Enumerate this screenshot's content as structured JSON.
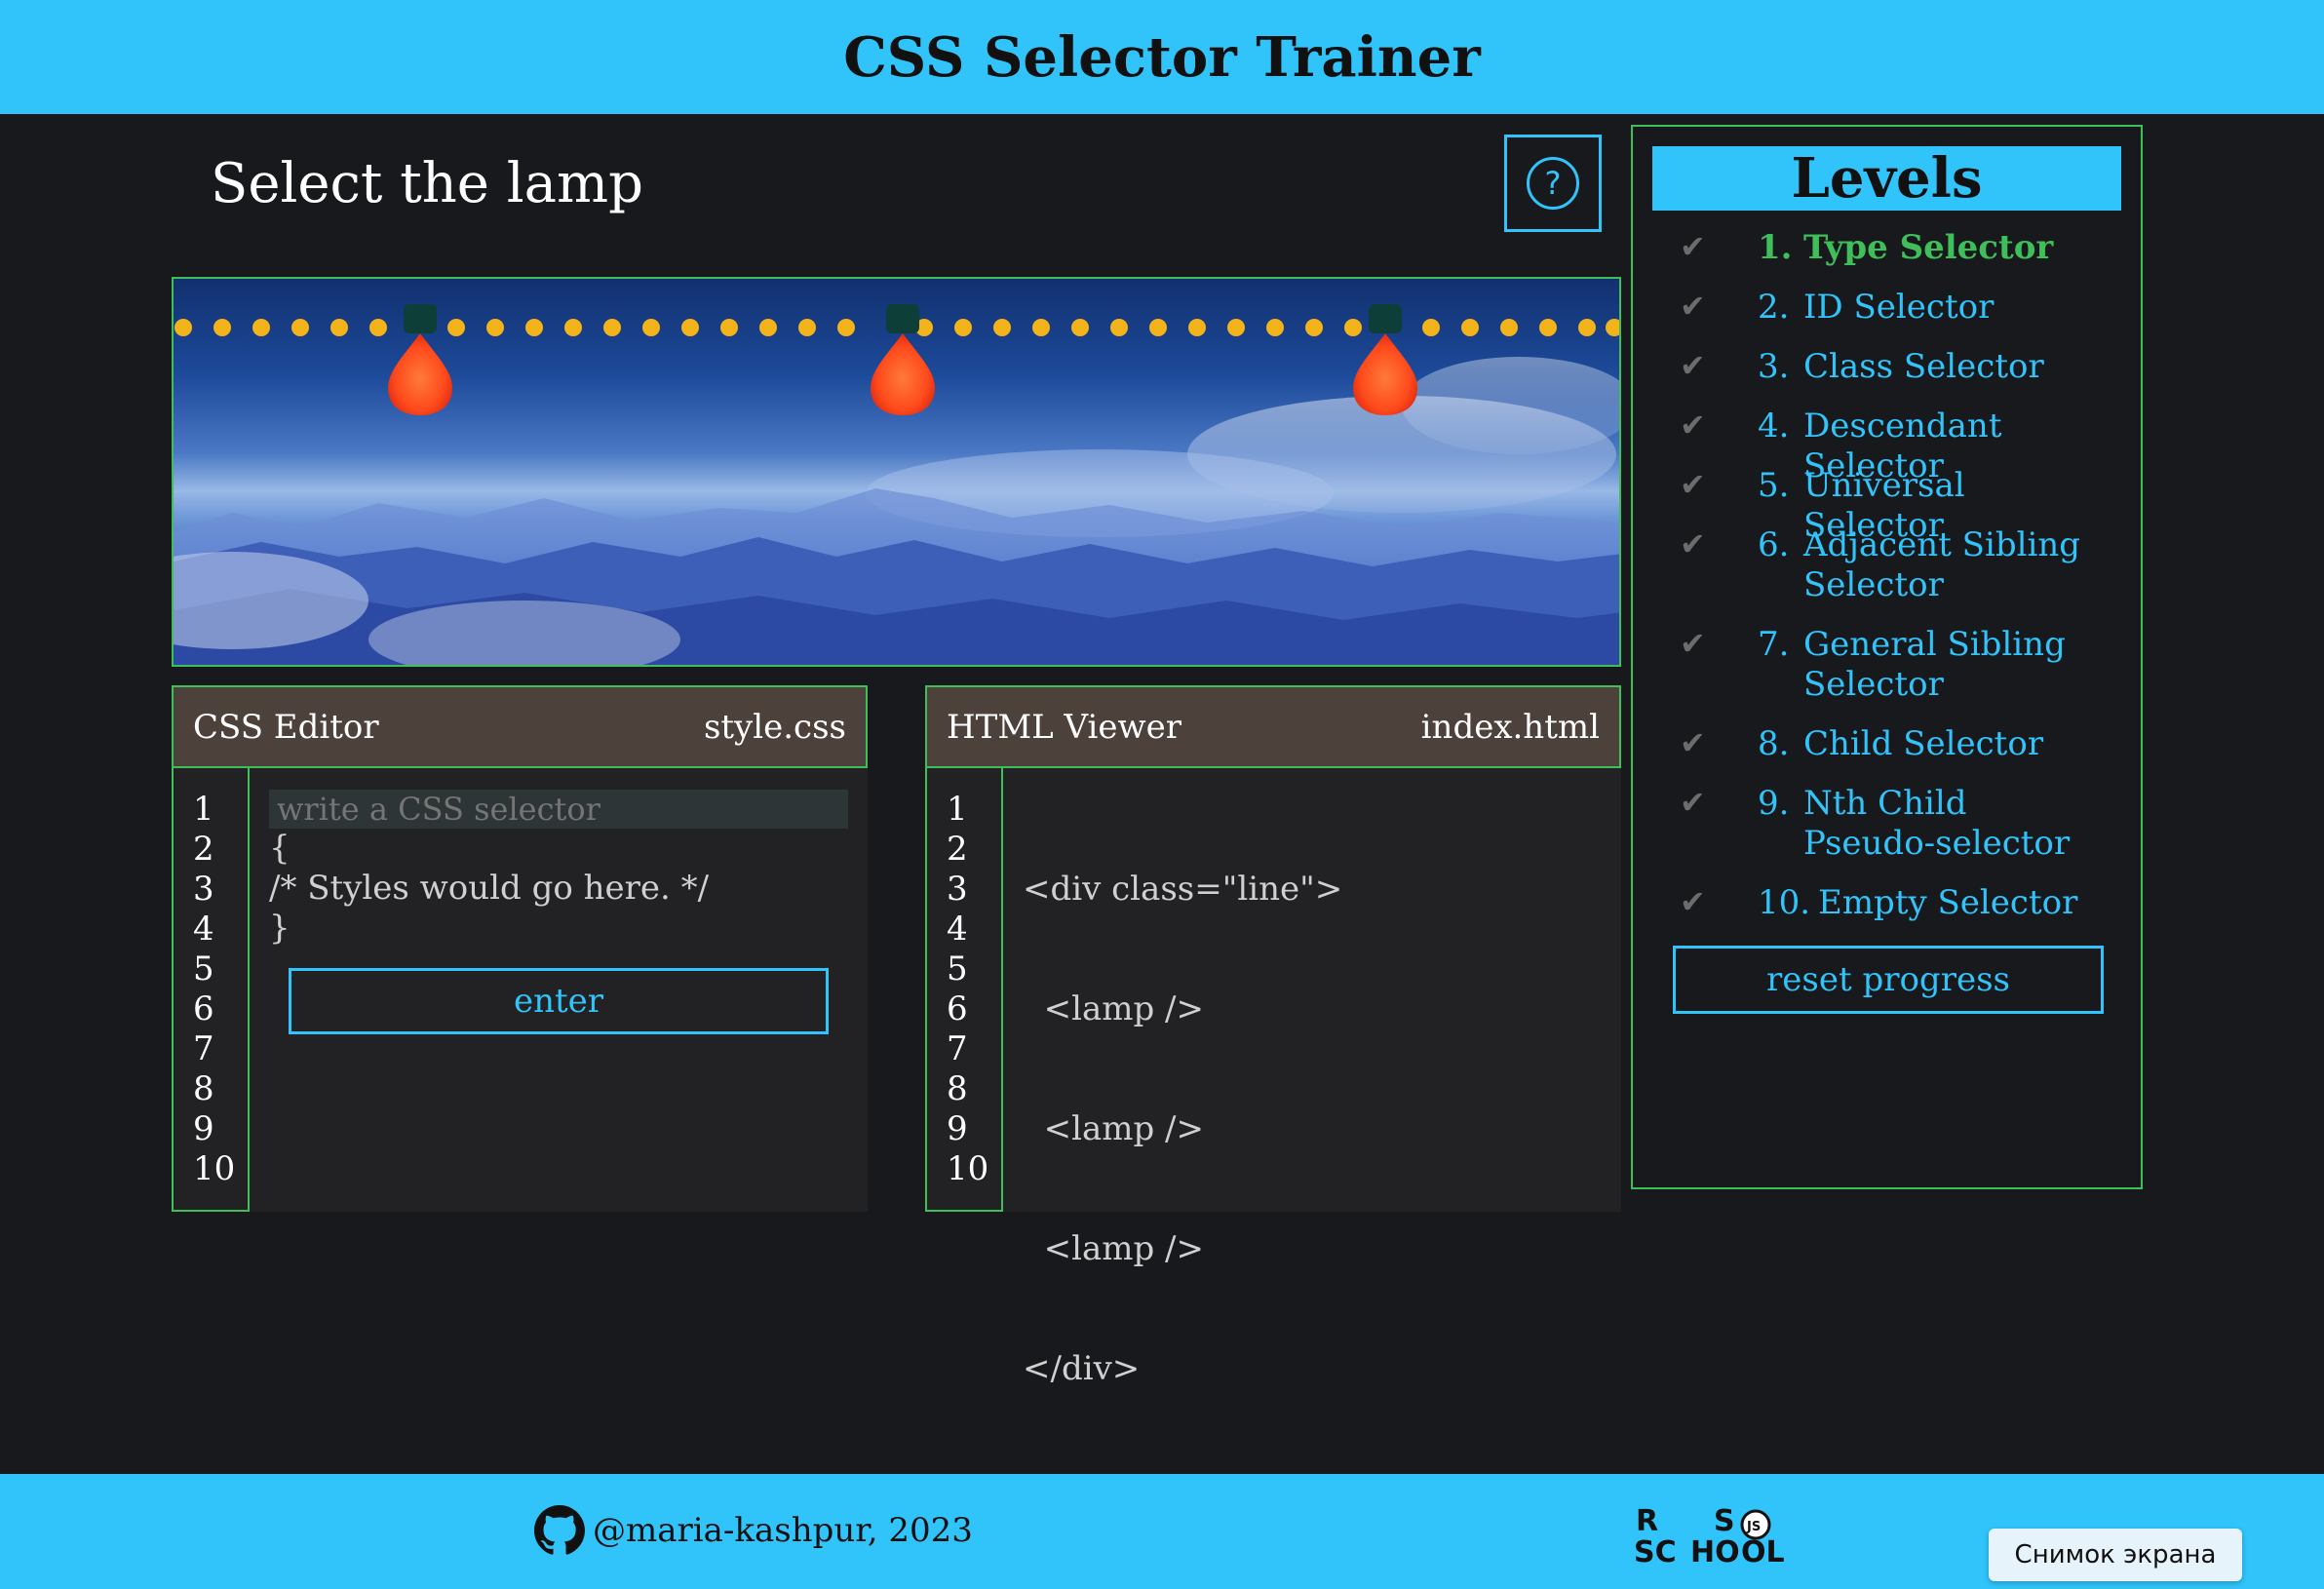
{
  "header": {
    "title": "CSS Selector Trainer"
  },
  "task": {
    "title": "Select the lamp",
    "help_icon": "?"
  },
  "css_editor": {
    "title": "CSS Editor",
    "filename": "style.css",
    "line_numbers": [
      "1",
      "2",
      "3",
      "4",
      "5",
      "6",
      "7",
      "8",
      "9",
      "10"
    ],
    "input_placeholder": "write a CSS selector",
    "lines": [
      "{",
      "/* Styles would go here. */",
      "}"
    ],
    "enter_label": "enter"
  },
  "html_viewer": {
    "title": "HTML Viewer",
    "filename": "index.html",
    "line_numbers": [
      "1",
      "2",
      "3",
      "4",
      "5",
      "6",
      "7",
      "8",
      "9",
      "10"
    ],
    "lines": [
      "<div class=\"line\">",
      "  <lamp />",
      "  <lamp />",
      "  <lamp />",
      "</div>"
    ]
  },
  "levels": {
    "title": "Levels",
    "items": [
      {
        "num": "1.",
        "label": "Type Selector",
        "active": true
      },
      {
        "num": "2.",
        "label": "ID Selector"
      },
      {
        "num": "3.",
        "label": "Class Selector"
      },
      {
        "num": "4.",
        "label": "Descendant Selector"
      },
      {
        "num": "5.",
        "label": "Universal Selector"
      },
      {
        "num": "6.",
        "label": "Adjacent Sibling Selector"
      },
      {
        "num": "7.",
        "label": "General Sibling Selector"
      },
      {
        "num": "8.",
        "label": "Child Selector"
      },
      {
        "num": "9.",
        "label": "Nth Child Pseudo-selector"
      },
      {
        "num": "10.",
        "label": "Empty Selector"
      }
    ],
    "check_icon": "checkmark-icon",
    "reset_label": "reset progress"
  },
  "footer": {
    "github_text": "@maria-kashpur, 2023",
    "github_icon": "github-icon",
    "logo_text": [
      "R",
      "S",
      "SC",
      "HO",
      "OL",
      "JS"
    ]
  },
  "overlay": {
    "snapshot_label": "Снимок экрана"
  },
  "colors": {
    "accent": "#31c4fb",
    "border": "#3fbf5a",
    "panel_head": "#4d413c",
    "background": "#18191d",
    "lamp": "#ff4a1c"
  }
}
